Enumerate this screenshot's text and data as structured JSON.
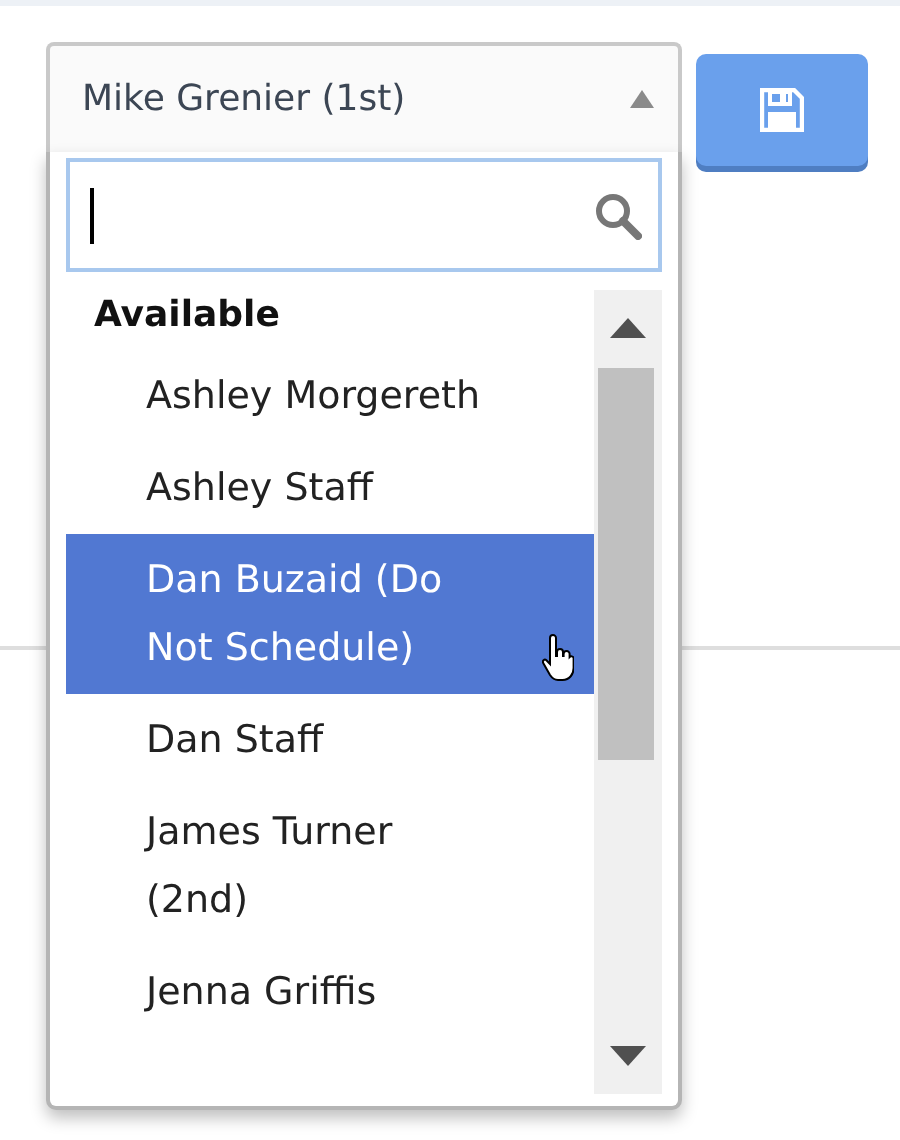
{
  "select": {
    "value": "Mike Grenier (1st)",
    "expanded": true
  },
  "search": {
    "focused": true
  },
  "groups": [
    {
      "label": "Available",
      "items": [
        {
          "label": "Ashley Morgereth",
          "selected": false
        },
        {
          "label": "Ashley Staff",
          "selected": false
        },
        {
          "label": "Dan Buzaid (Do Not Schedule)",
          "selected": true
        },
        {
          "label": "Dan Staff",
          "selected": false
        },
        {
          "label": "James Turner (2nd)",
          "selected": false
        },
        {
          "label": "Jenna Griffis",
          "selected": false
        }
      ]
    }
  ],
  "save_button": {
    "kind": "save"
  }
}
